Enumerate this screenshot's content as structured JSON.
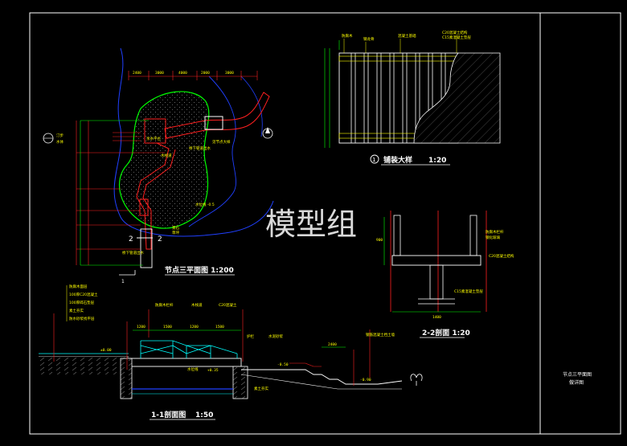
{
  "titles": {
    "plan": "节点三平面图 1:200",
    "paving": "铺装大样",
    "paving_scale": "1:20",
    "paving_marker": "1",
    "section_22": "2-2剖面 1:20",
    "section_11": "1-1剖面图",
    "section_11_scale": "1:50"
  },
  "watermark": "模型组",
  "title_block": {
    "line1": "节点三平面图",
    "line2": "做详图"
  },
  "plan": {
    "dims_top": [
      "2400",
      "3000",
      "4000",
      "2000",
      "3000"
    ],
    "cut_label": "2",
    "cut_label_b": "2",
    "section_mark": "1",
    "label_deck": "亲水平台",
    "label_water": "水体",
    "label_lawn": "草坪",
    "label_rock": "景石",
    "label_path": "汀步",
    "label_wood": "木栈道",
    "label_level": "水位线 -0.5",
    "label_bridge": "桥下管道出水",
    "label_bridge2": "桥下管道出水",
    "label_detail": "见节点大样"
  },
  "paving_labels": [
    "防腐木",
    "钢龙骨",
    "混凝土基础",
    "C20混凝土结构",
    "C15素混凝土垫层"
  ],
  "section22_labels": [
    "防腐木栏杆",
    "钢化玻璃",
    "C20混凝土结构",
    "C15素混凝土垫层"
  ],
  "section22_dims": [
    "900",
    "1400"
  ],
  "section11_layers": [
    "防腐木面层",
    "100厚C20混凝土",
    "100厚碎石垫层",
    "素土夯实",
    "防水砂浆找平层"
  ],
  "section11_labels": [
    "防腐木栏杆",
    "木栈道",
    "C20混凝土",
    "护栏",
    "水泥砂浆",
    "水位线",
    "素土夯实",
    "钢筋混凝土挡土墙"
  ],
  "section11_dims": [
    "1200",
    "1500",
    "1200",
    "1500",
    "2400"
  ],
  "section11_levels": [
    "±0.00",
    "-0.50",
    "+0.35",
    "-0.90"
  ],
  "colors": {
    "background": "#000000",
    "frame": "#ffffff",
    "line_red": "#ff2020",
    "line_green": "#00ff00",
    "line_blue": "#2040ff",
    "line_yellow": "#ffff00",
    "line_cyan": "#00ffff",
    "line_grey": "#9a9a9a"
  }
}
